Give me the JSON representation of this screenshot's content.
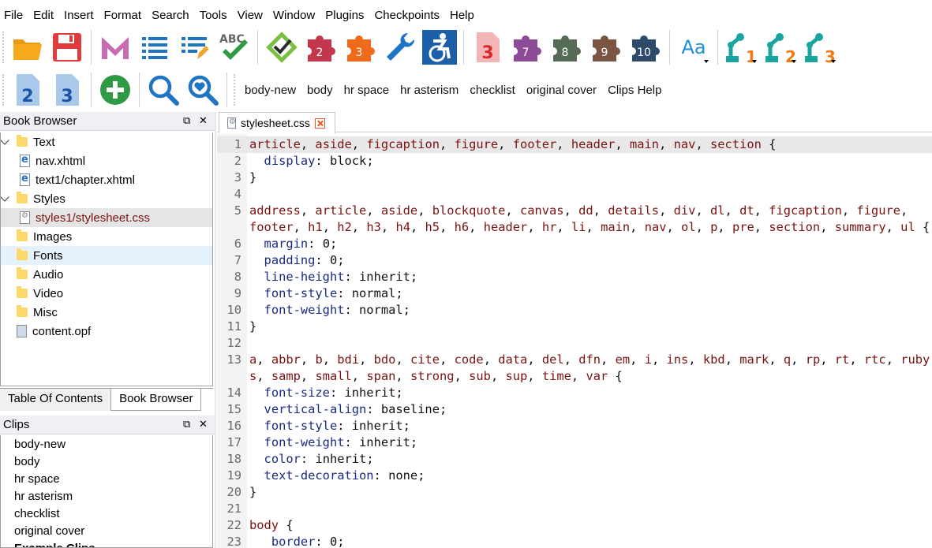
{
  "menu": [
    "File",
    "Edit",
    "Insert",
    "Format",
    "Search",
    "Tools",
    "View",
    "Window",
    "Plugins",
    "Checkpoints",
    "Help"
  ],
  "toolbar1": {
    "puzzle_numbers": [
      "2",
      "3"
    ],
    "heading_numbers": [
      "3",
      "7",
      "8",
      "9",
      "10"
    ],
    "font_label": "Aa",
    "clip_numbers": [
      "1",
      "2",
      "3"
    ],
    "spell_label": "ABC"
  },
  "toolbar2": {
    "heading_numbers": [
      "2",
      "3"
    ],
    "clips": [
      "body-new",
      "body",
      "hr space",
      "hr asterism",
      "checklist",
      "original cover",
      "Clips Help"
    ]
  },
  "book_browser": {
    "title": "Book Browser",
    "items": [
      {
        "label": "Text",
        "type": "folder",
        "level": 0,
        "expanded": true
      },
      {
        "label": "nav.xhtml",
        "type": "web",
        "level": 1
      },
      {
        "label": "text1/chapter.xhtml",
        "type": "web",
        "level": 1
      },
      {
        "label": "Styles",
        "type": "folder",
        "level": 0,
        "expanded": true
      },
      {
        "label": "styles1/stylesheet.css",
        "type": "gear",
        "level": 1,
        "selected": true
      },
      {
        "label": "Images",
        "type": "folder",
        "level": 0
      },
      {
        "label": "Fonts",
        "type": "folder",
        "level": 0,
        "hover": true
      },
      {
        "label": "Audio",
        "type": "folder",
        "level": 0
      },
      {
        "label": "Video",
        "type": "folder",
        "level": 0
      },
      {
        "label": "Misc",
        "type": "folder",
        "level": 0
      },
      {
        "label": "content.opf",
        "type": "opf",
        "level": 0
      }
    ]
  },
  "bottom_tabs": [
    "Table Of Contents",
    "Book Browser"
  ],
  "clips_panel": {
    "title": "Clips",
    "items": [
      "body-new",
      "body",
      "hr space",
      "hr asterism",
      "checklist",
      "original cover"
    ],
    "group": "Example Clips"
  },
  "editor": {
    "tab_label": "stylesheet.css",
    "lines": [
      {
        "n": "1",
        "text": "article, aside, figcaption, figure, footer, header, main, nav, section {"
      },
      {
        "n": "2",
        "text": "  display: block;"
      },
      {
        "n": "3",
        "text": "}"
      },
      {
        "n": "4",
        "text": ""
      },
      {
        "n": "5",
        "text": "address, article, aside, blockquote, canvas, dd, details, div, dl, dt, figcaption, figure,"
      },
      {
        "n": "",
        "text": "footer, h1, h2, h3, h4, h5, h6, header, hr, li, main, nav, ol, p, pre, section, summary, ul {"
      },
      {
        "n": "6",
        "text": "  margin: 0;"
      },
      {
        "n": "7",
        "text": "  padding: 0;"
      },
      {
        "n": "8",
        "text": "  line-height: inherit;"
      },
      {
        "n": "9",
        "text": "  font-style: normal;"
      },
      {
        "n": "10",
        "text": "  font-weight: normal;"
      },
      {
        "n": "11",
        "text": "}"
      },
      {
        "n": "12",
        "text": ""
      },
      {
        "n": "13",
        "text": "a, abbr, b, bdi, bdo, cite, code, data, del, dfn, em, i, ins, kbd, mark, q, rp, rt, rtc, ruby,"
      },
      {
        "n": "",
        "text": "s, samp, small, span, strong, sub, sup, time, var {"
      },
      {
        "n": "14",
        "text": "  font-size: inherit;"
      },
      {
        "n": "15",
        "text": "  vertical-align: baseline;"
      },
      {
        "n": "16",
        "text": "  font-style: inherit;"
      },
      {
        "n": "17",
        "text": "  font-weight: inherit;"
      },
      {
        "n": "18",
        "text": "  color: inherit;"
      },
      {
        "n": "19",
        "text": "  text-decoration: none;"
      },
      {
        "n": "20",
        "text": "}"
      },
      {
        "n": "21",
        "text": ""
      },
      {
        "n": "22",
        "text": "body {"
      },
      {
        "n": "23",
        "text": "   border: 0;"
      }
    ]
  },
  "colors": {
    "selector": "#7a1212",
    "property": "#1a2a84",
    "current_line": "#e8e8e8",
    "gutter": "#f3f3f3",
    "folder": "#fdd86a",
    "close_tab": "#e05a2a"
  }
}
